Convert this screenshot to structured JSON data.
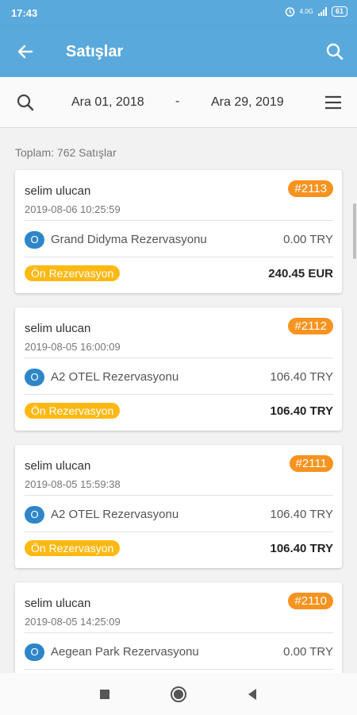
{
  "status_bar": {
    "time": "17:43",
    "network": "4.0G",
    "battery": "61"
  },
  "appbar": {
    "title": "Satışlar"
  },
  "filter": {
    "start_date": "Ara 01, 2018",
    "separator": "-",
    "end_date": "Ara 29, 2019"
  },
  "summary": {
    "total_label": "Toplam: 762 Satışlar"
  },
  "sales": [
    {
      "customer": "selim ulucan",
      "datetime": "2019-08-06 10:25:59",
      "id": "#2113",
      "hotel_badge": "O",
      "hotel": "Grand Didyma Rezervasyonu",
      "price": "0.00 TRY",
      "status": "Ön Rezervasyon",
      "total": "240.45 EUR"
    },
    {
      "customer": "selim ulucan",
      "datetime": "2019-08-05 16:00:09",
      "id": "#2112",
      "hotel_badge": "O",
      "hotel": "A2 OTEL Rezervasyonu",
      "price": "106.40 TRY",
      "status": "Ön Rezervasyon",
      "total": "106.40 TRY"
    },
    {
      "customer": "selim ulucan",
      "datetime": "2019-08-05 15:59:38",
      "id": "#2111",
      "hotel_badge": "O",
      "hotel": "A2 OTEL Rezervasyonu",
      "price": "106.40 TRY",
      "status": "Ön Rezervasyon",
      "total": "106.40 TRY"
    },
    {
      "customer": "selim ulucan",
      "datetime": "2019-08-05 14:25:09",
      "id": "#2110",
      "hotel_badge": "O",
      "hotel": "Aegean Park Rezervasyonu",
      "price": "0.00 TRY",
      "status": "",
      "total": ""
    }
  ],
  "icons": {
    "back": "arrow-left-icon",
    "search": "search-icon",
    "filter_search": "search-icon",
    "menu": "menu-icon",
    "nav_recent": "square-icon",
    "nav_home": "circle-icon",
    "nav_back": "triangle-left-icon"
  },
  "colors": {
    "primary": "#5aa9dc",
    "id_badge": "#f7931e",
    "status_badge": "#fdb913",
    "hotel_badge": "#2e86c9"
  }
}
